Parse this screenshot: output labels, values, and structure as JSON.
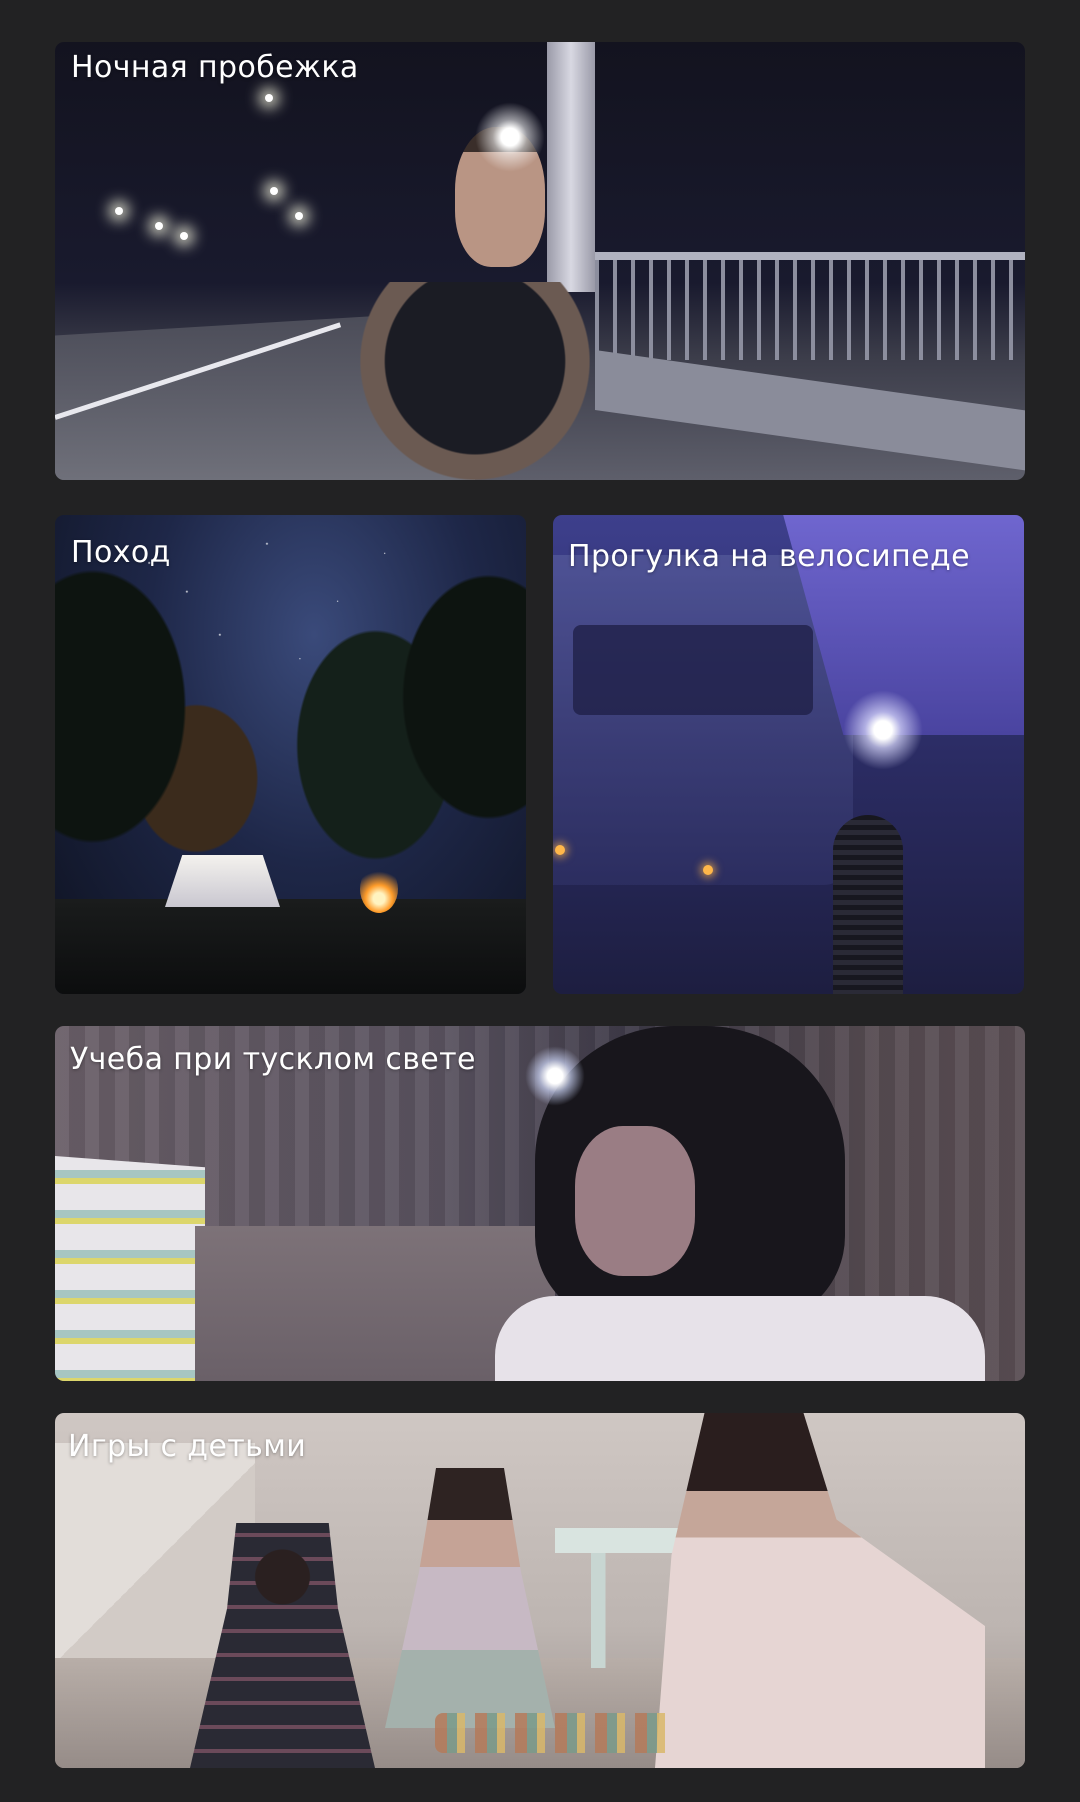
{
  "cards": [
    {
      "label": "Ночная пробежка"
    },
    {
      "label": "Поход"
    },
    {
      "label": "Прогулка на велосипеде"
    },
    {
      "label": "Учеба при тусклом свете"
    },
    {
      "label": "Игры с детьми"
    }
  ]
}
